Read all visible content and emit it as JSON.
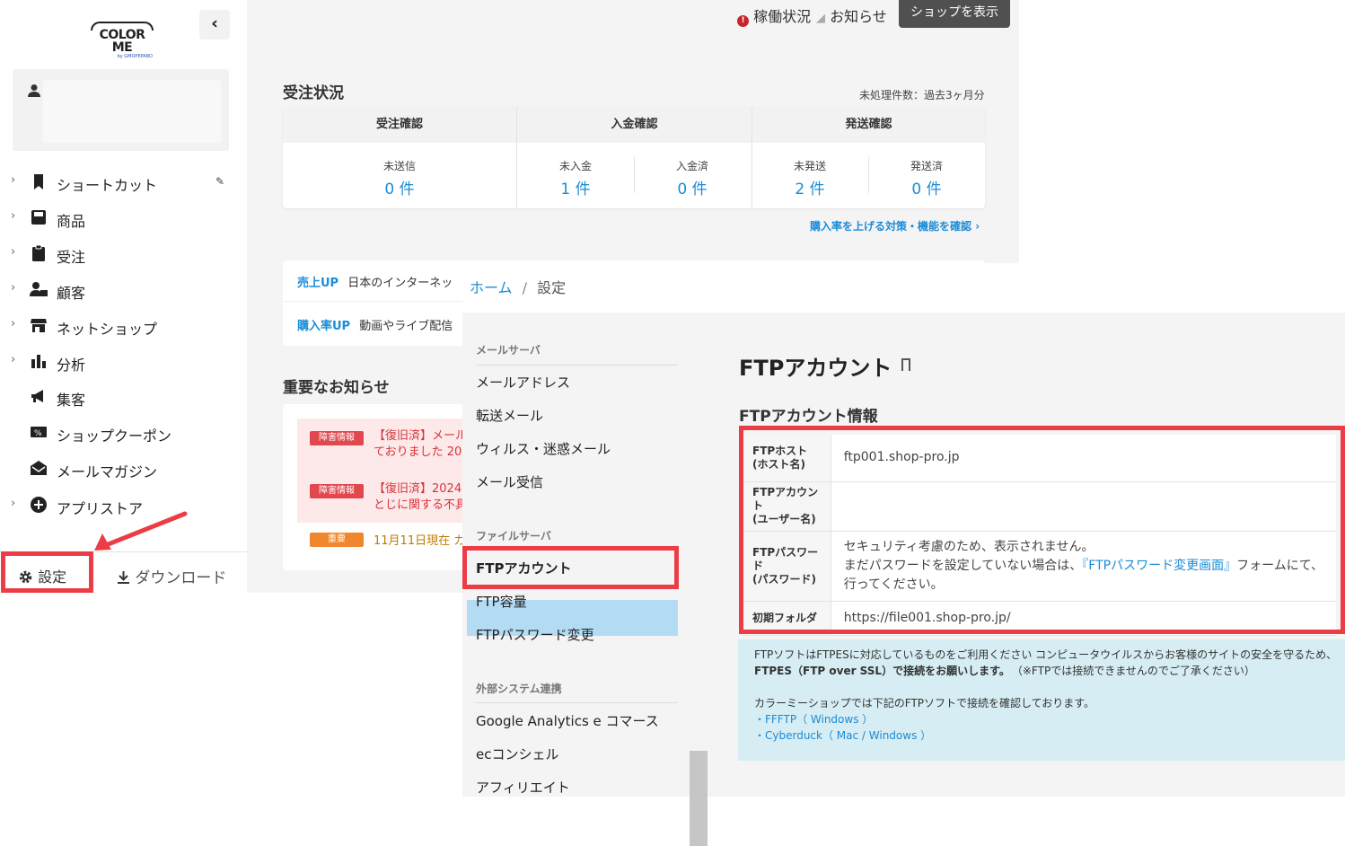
{
  "sidebar": {
    "logo_main": "COLOR ME",
    "logo_sub": "by GMOPEPABO",
    "collapse_icon": "chevron-left-icon",
    "nav": [
      {
        "label": "ショートカット",
        "icon": "bookmark-icon",
        "has_chevron": true,
        "has_edit": true
      },
      {
        "label": "商品",
        "icon": "product-icon",
        "has_chevron": true
      },
      {
        "label": "受注",
        "icon": "clipboard-icon",
        "has_chevron": true
      },
      {
        "label": "顧客",
        "icon": "customer-icon",
        "has_chevron": true
      },
      {
        "label": "ネットショップ",
        "icon": "store-icon",
        "has_chevron": true
      },
      {
        "label": "分析",
        "icon": "bar-chart-icon",
        "has_chevron": true
      },
      {
        "label": "集客",
        "icon": "megaphone-icon",
        "has_chevron": false
      },
      {
        "label": "ショップクーポン",
        "icon": "coupon-icon",
        "has_chevron": false
      },
      {
        "label": "メールマガジン",
        "icon": "mail-open-icon",
        "has_chevron": false
      },
      {
        "label": "アプリストア",
        "icon": "plus-circle-icon",
        "has_chevron": true
      }
    ],
    "settings_label": "設定",
    "download_label": "ダウンロード",
    "highlight_color": "#ec3d46"
  },
  "dashboard": {
    "status_operation": "稼働状況",
    "status_news": "お知らせ",
    "view_shop_button": "ショップを表示",
    "orders_title": "受注状況",
    "orders_note": "未処理件数：過去3ヶ月分",
    "groups": [
      "受注確認",
      "入金確認",
      "発送確認"
    ],
    "cells": [
      {
        "label": "未送信",
        "value": "0 件"
      },
      {
        "label": "未入金",
        "value": "1 件"
      },
      {
        "label": "入金済",
        "value": "0 件"
      },
      {
        "label": "未発送",
        "value": "2 件"
      },
      {
        "label": "発送済",
        "value": "0 件"
      }
    ],
    "improve_link": "購入率を上げる対策・機能を確認",
    "promo1_tag": "売上UP",
    "promo1_text": "日本のインターネッ",
    "promo2_tag": "購入率UP",
    "promo2_text": "動画やライブ配信",
    "notices_title": "重要なお知らせ",
    "notices": [
      {
        "badge": "障害情報",
        "line1": "【復旧済】メール",
        "line2": "ておりました 20"
      },
      {
        "badge": "障害情報",
        "line1": "【復旧済】2024",
        "line2": "とじに関する不具"
      },
      {
        "badge": "重要",
        "line1": "11月11日現在 カ",
        "line2": ""
      }
    ],
    "accent_color": "#1a8cd8"
  },
  "settings": {
    "breadcrumb_home": "ホーム",
    "breadcrumb_sep": "/",
    "breadcrumb_current": "設定",
    "menu": {
      "mail_category": "メールサーバ",
      "mail_items": [
        "メールアドレス",
        "転送メール",
        "ウィルス・迷惑メール",
        "メール受信"
      ],
      "file_category": "ファイルサーバ",
      "file_items": [
        "FTPアカウント",
        "FTP容量",
        "FTPパスワード変更"
      ],
      "ext_category": "外部システム連携",
      "ext_items": [
        "Google Analytics e コマース",
        "ecコンシェル",
        "アフィリエイト"
      ],
      "active_item": "FTPアカウント",
      "active_color": "#b3dcf4"
    },
    "title": "FTPアカウント",
    "info_title": "FTPアカウント情報",
    "table": [
      {
        "th1": "FTPホスト",
        "th2": "(ホスト名)",
        "value": "ftp001.shop-pro.jp"
      },
      {
        "th1": "FTPアカウント",
        "th2": "(ユーザー名)",
        "value": ""
      },
      {
        "th1": "FTPパスワード",
        "th2": "(パスワード)",
        "line1": "セキュリティ考慮のため、表示されません。",
        "line2a": "まだパスワードを設定していない場合は、",
        "line2link": "『FTPパスワード変更画面』",
        "line2b": "フォームにて、",
        "line3": "行ってください。"
      },
      {
        "th1": "初期フォルダ",
        "th2": "",
        "value": "https://file001.shop-pro.jp/"
      }
    ],
    "notice": {
      "line1": "FTPソフトはFTPESに対応しているものをご利用ください コンピュータウイルスからお客様のサイトの安全を守るため、",
      "line2bold": "FTPES（FTP over SSL）で接続をお願いします。",
      "line2": "（※FTPでは接続できませんのでご了承ください）",
      "line3": "カラーミーショップでは下記のFTPソフトで接続を確認しております。",
      "soft1": "・FFFTP（ Windows ）",
      "soft2": "・Cyberduck（ Mac / Windows ）"
    },
    "panel_bg": "#d6edf3"
  }
}
